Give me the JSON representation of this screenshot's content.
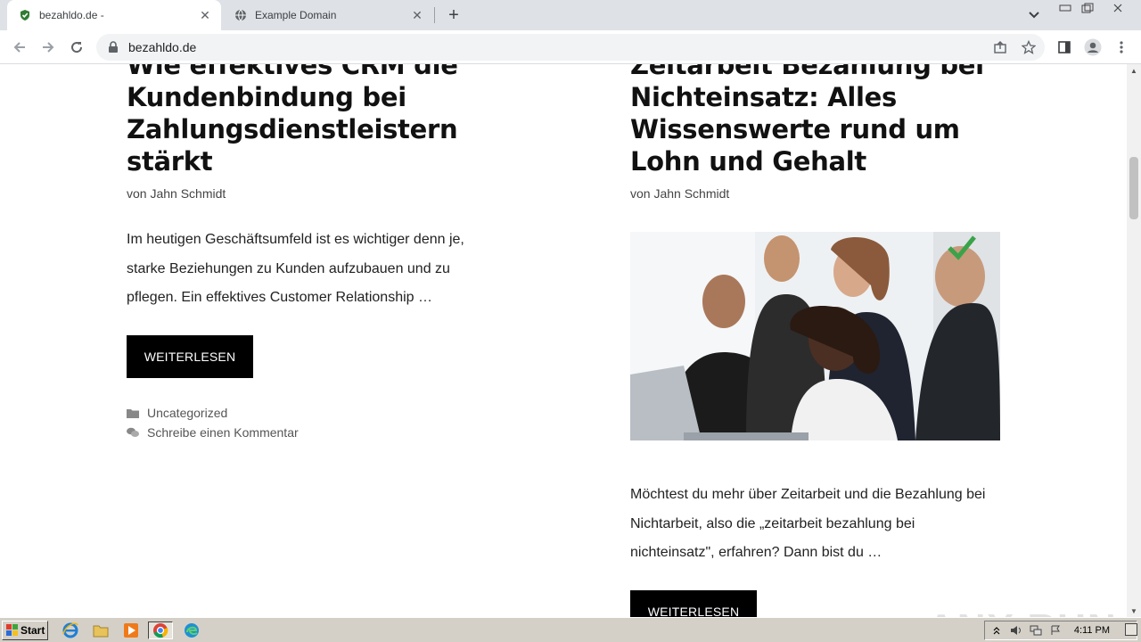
{
  "browser": {
    "tabs": [
      {
        "title": "bezahldo.de -",
        "active": true
      },
      {
        "title": "Example Domain",
        "active": false
      }
    ],
    "url": "bezahldo.de"
  },
  "posts": [
    {
      "title": "Wie effektives CRM die Kundenbindung bei Zahlungsdienstleistern stärkt",
      "byline_prefix": "von",
      "author": "Jahn Schmidt",
      "excerpt": "Im heutigen Geschäftsumfeld ist es wichtiger denn je, starke Beziehungen zu Kunden aufzubauen und zu pflegen. Ein effektives Customer Relationship …",
      "button": "WEITERLESEN",
      "category": "Uncategorized",
      "comment": "Schreibe einen Kommentar"
    },
    {
      "title": "Zeitarbeit Bezahlung bei Nichteinsatz: Alles Wissenswerte rund um Lohn und Gehalt",
      "byline_prefix": "von",
      "author": "Jahn Schmidt",
      "excerpt": "Möchtest du mehr über Zeitarbeit und die Bezahlung bei Nichtarbeit, also die „zeitarbeit bezahlung bei nichteinsatz\", erfahren? Dann bist du …",
      "button": "WEITERLESEN"
    }
  ],
  "watermark": "ANY RUN",
  "taskbar": {
    "start_label": "Start",
    "clock": "4:11 PM"
  },
  "colors": {
    "button_bg": "#000000",
    "tabstrip_bg": "#dee1e6",
    "taskbar_bg": "#d4d0c8"
  }
}
